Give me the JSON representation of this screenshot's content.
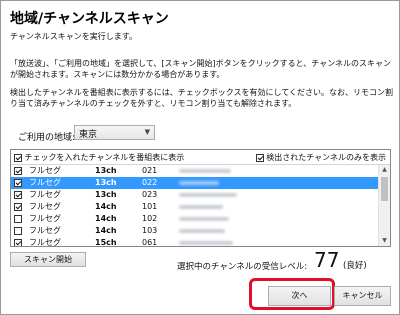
{
  "window": {
    "title": "地域/チャンネルスキャン",
    "intro": "チャンネルスキャンを実行します。",
    "desc1": "「放送波」、「ご利用の地域」を選択して、[スキャン開始]ボタンをクリックすると、チャンネルのスキャンが開始されます。スキャンには数分かかる場合があります。",
    "desc2": "検出したチャンネルを番組表に表示するには、チェックボックスを有効にしてください。なお、リモコン割り当て済みチャンネルのチェックを外すと、リモコン割り当ても解除されます。"
  },
  "region": {
    "label": "ご利用の地域:",
    "value": "東京"
  },
  "list": {
    "header_left": "チェックを入れたチャンネルを番組表に表示",
    "header_left_checked": true,
    "header_right": "検出されたチャンネルのみを表示",
    "header_right_checked": true,
    "rows": [
      {
        "checked": true,
        "type": "フルセグ",
        "ch": "13ch",
        "num": "021",
        "selected": false
      },
      {
        "checked": true,
        "type": "フルセグ",
        "ch": "13ch",
        "num": "022",
        "selected": true
      },
      {
        "checked": true,
        "type": "フルセグ",
        "ch": "13ch",
        "num": "023",
        "selected": false
      },
      {
        "checked": true,
        "type": "フルセグ",
        "ch": "14ch",
        "num": "101",
        "selected": false
      },
      {
        "checked": false,
        "type": "フルセグ",
        "ch": "14ch",
        "num": "102",
        "selected": false
      },
      {
        "checked": false,
        "type": "フルセグ",
        "ch": "14ch",
        "num": "103",
        "selected": false
      },
      {
        "checked": true,
        "type": "フルセグ",
        "ch": "15ch",
        "num": "061",
        "selected": false
      }
    ]
  },
  "scan_button": "スキャン開始",
  "level": {
    "label": "選択中のチャンネルの受信レベル:",
    "value": "77",
    "quality": "(良好)"
  },
  "buttons": {
    "next": "次へ",
    "cancel": "キャンセル"
  },
  "colors": {
    "selection": "#3399ff",
    "highlight": "#e0102a"
  }
}
